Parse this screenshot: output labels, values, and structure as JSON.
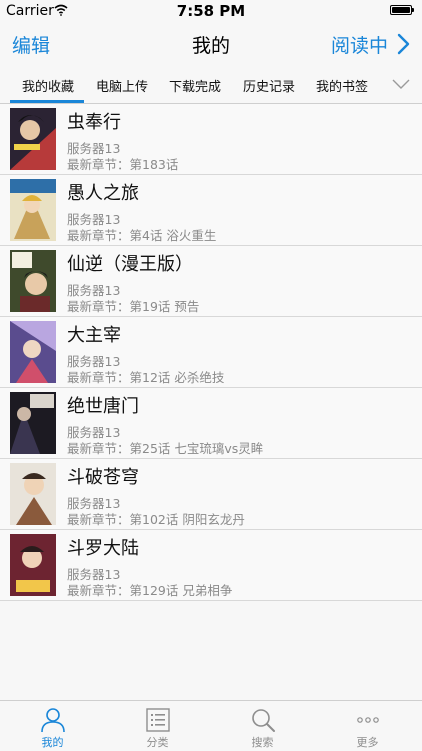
{
  "status_bar": {
    "carrier": "Carrier",
    "time": "7:58 PM"
  },
  "nav": {
    "edit": "编辑",
    "title": "我的",
    "reading": "阅读中"
  },
  "tabs": [
    {
      "label": "我的收藏",
      "active": true
    },
    {
      "label": "电脑上传",
      "active": false
    },
    {
      "label": "下载完成",
      "active": false
    },
    {
      "label": "历史记录",
      "active": false
    },
    {
      "label": "我的书签",
      "active": false
    }
  ],
  "comics": [
    {
      "title": "虫奉行",
      "server": "服务器13",
      "latest": "最新章节：第183话"
    },
    {
      "title": "愚人之旅",
      "server": "服务器13",
      "latest": "最新章节：第4话 浴火重生"
    },
    {
      "title": "仙逆（漫王版）",
      "server": "服务器13",
      "latest": "最新章节：第19话 预告"
    },
    {
      "title": "大主宰",
      "server": "服务器13",
      "latest": "最新章节：第12话 必杀绝技"
    },
    {
      "title": "绝世唐门",
      "server": "服务器13",
      "latest": "最新章节：第25话 七宝琉璃vs灵眸"
    },
    {
      "title": "斗破苍穹",
      "server": "服务器13",
      "latest": "最新章节：第102话 阴阳玄龙丹"
    },
    {
      "title": "斗罗大陆",
      "server": "服务器13",
      "latest": "最新章节：第129话 兄弟相争"
    }
  ],
  "tab_bar": [
    {
      "label": "我的",
      "icon": "person-icon",
      "active": true
    },
    {
      "label": "分类",
      "icon": "list-icon",
      "active": false
    },
    {
      "label": "搜索",
      "icon": "search-icon",
      "active": false
    },
    {
      "label": "更多",
      "icon": "more-icon",
      "active": false
    }
  ],
  "colors": {
    "accent": "#1a86d8",
    "muted": "#8a8a8a",
    "background": "#f7f7f7"
  }
}
